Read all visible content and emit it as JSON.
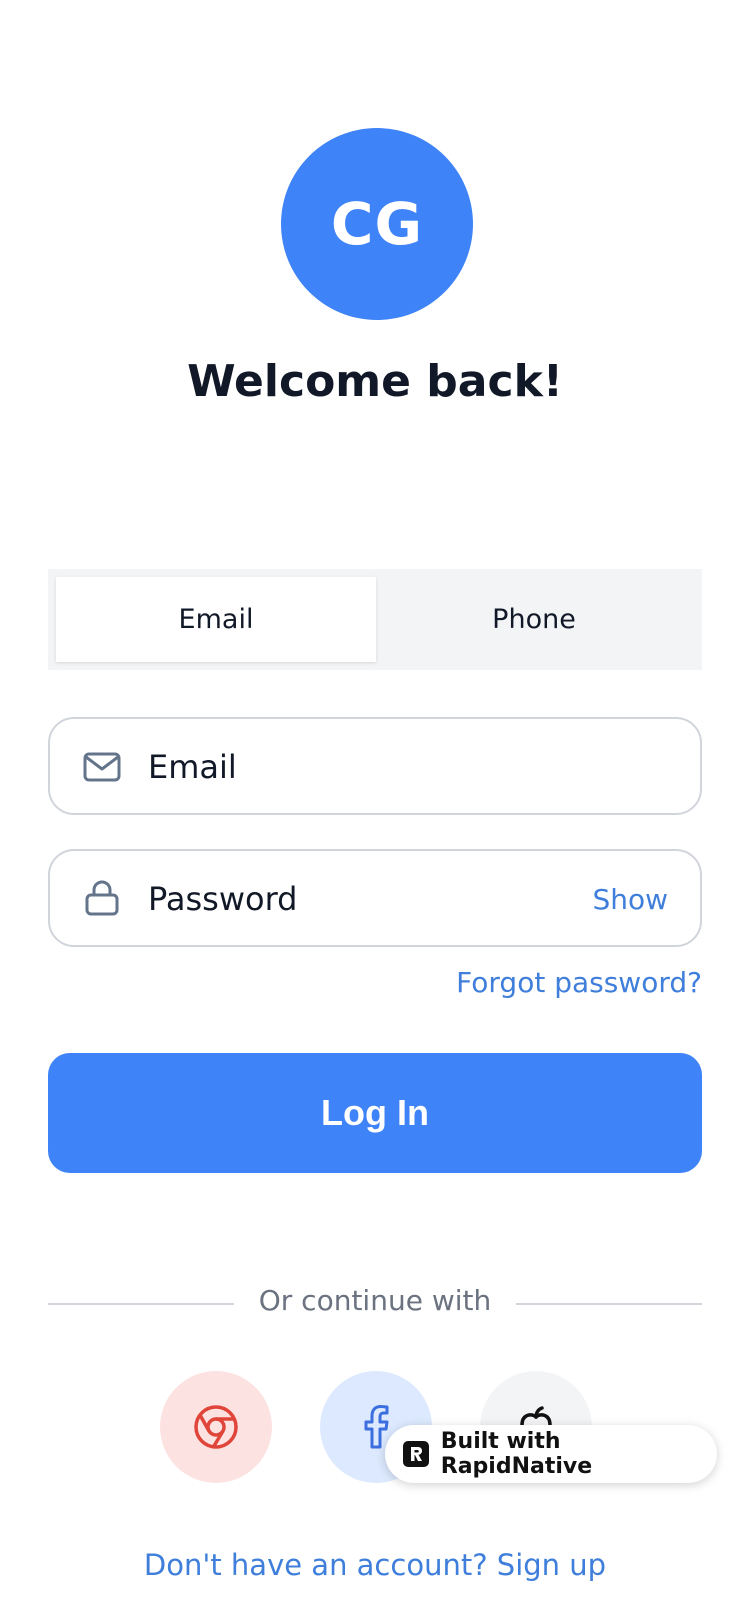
{
  "avatar": {
    "initials": "CG"
  },
  "title": "Welcome back!",
  "tabs": [
    {
      "label": "Email",
      "active": true
    },
    {
      "label": "Phone",
      "active": false
    }
  ],
  "email_field": {
    "placeholder": "Email",
    "value": "",
    "icon": "mail-icon"
  },
  "password_field": {
    "placeholder": "Password",
    "value": "",
    "icon": "lock-icon",
    "show_label": "Show"
  },
  "forgot_password": "Forgot password?",
  "login_button": "Log In",
  "divider_text": "Or continue with",
  "social": [
    {
      "name": "Google",
      "icon": "chrome-icon",
      "color": "#E0453A"
    },
    {
      "name": "Facebook",
      "icon": "facebook-icon",
      "color": "#3B6FE0"
    },
    {
      "name": "Apple",
      "icon": "apple-icon",
      "color": "#111111"
    }
  ],
  "badge": {
    "text": "Built with RapidNative"
  },
  "signup_text": "Don't have an account? Sign up",
  "colors": {
    "primary": "#3F83F8",
    "link": "#3F7FDB",
    "title": "#111827"
  }
}
